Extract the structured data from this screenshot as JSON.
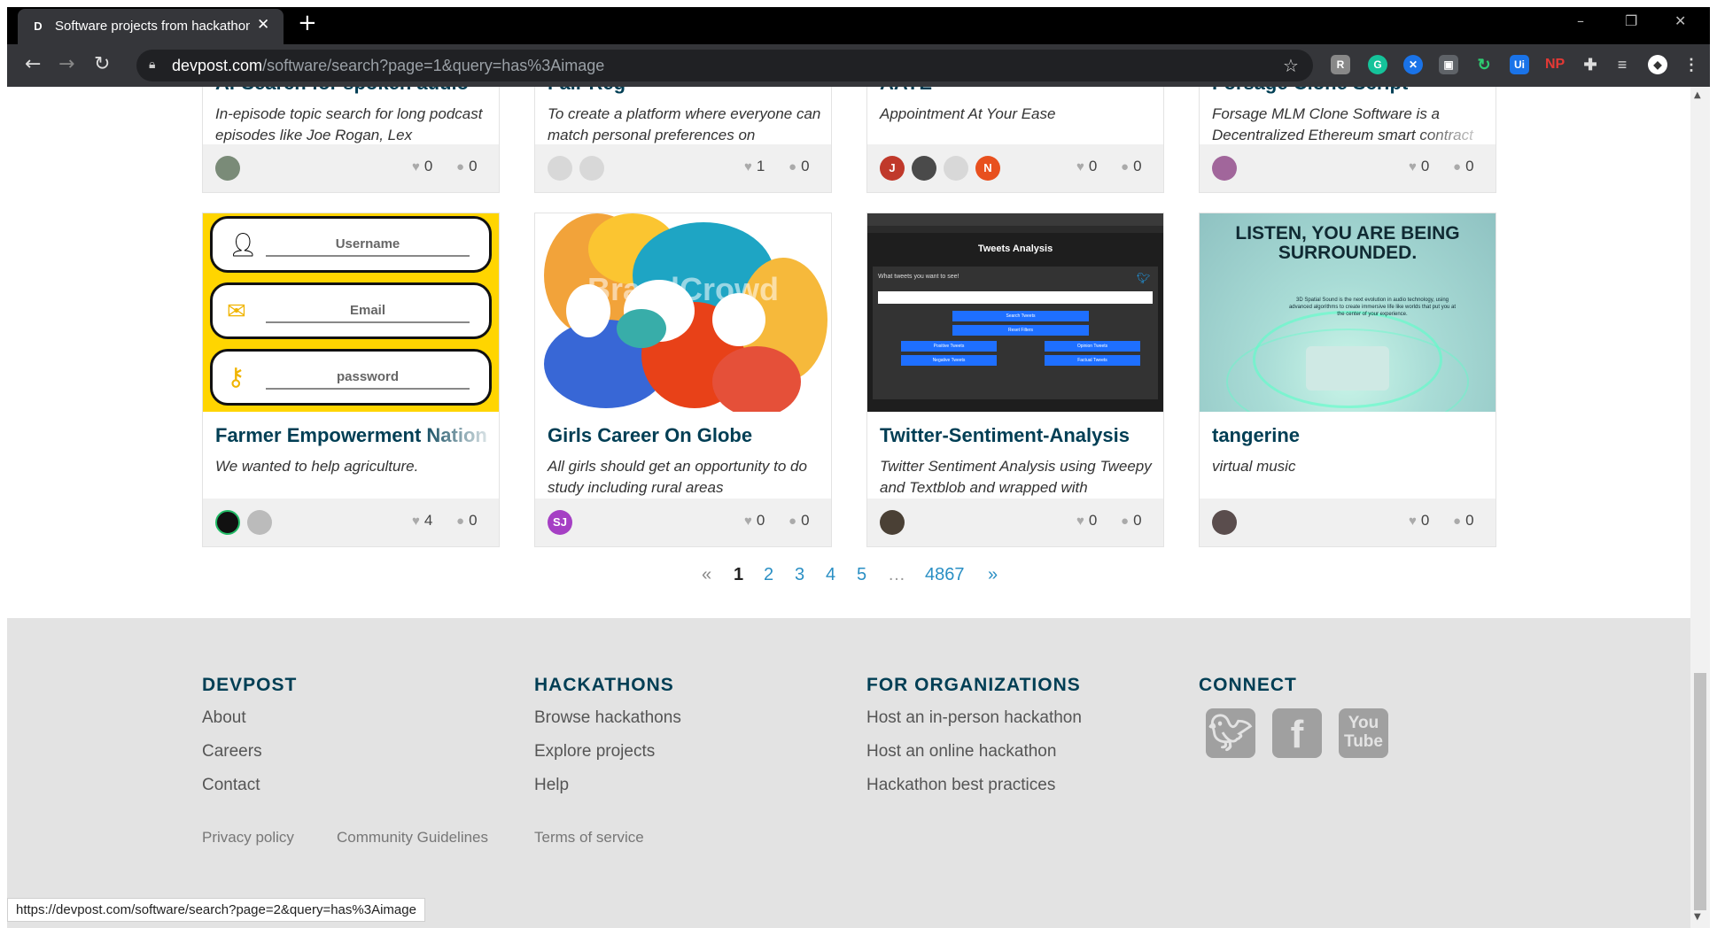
{
  "browser": {
    "tab_favicon": "D",
    "tab_title": "Software projects from hackathon",
    "url_domain": "devpost.com",
    "url_path": "/software/search?page=1&query=has%3Aimage",
    "status_url": "https://devpost.com/software/search?page=2&query=has%3Aimage",
    "ext": [
      "G",
      "Ui",
      "NP"
    ]
  },
  "top_cards": [
    {
      "title": "AI-Search for spoken audio",
      "tagline": "In-episode topic search for long podcast episodes like Joe Rogan, Lex",
      "likes": "0",
      "comments": "0"
    },
    {
      "title": "Fair Reg",
      "tagline": "To create a platform where everyone can match personal preferences on",
      "likes": "1",
      "comments": "0"
    },
    {
      "title": "AAYE",
      "tagline": "Appointment At Your Ease",
      "likes": "0",
      "comments": "0",
      "avatars": [
        "J",
        "N"
      ]
    },
    {
      "title": "Forsage Clone Script",
      "tagline": "Forsage MLM Clone Software is a Decentralized Ethereum smart contract",
      "likes": "0",
      "comments": "0"
    }
  ],
  "cards": [
    {
      "title": "Farmer Empowerment Nation",
      "tagline": "We wanted to help agriculture.",
      "likes": "4",
      "comments": "0",
      "image": {
        "fields": [
          "Username",
          "Email",
          "password"
        ]
      }
    },
    {
      "title": "Girls Career On Globe",
      "tagline": "All girls should get an opportunity to do study including rural areas",
      "likes": "0",
      "comments": "0",
      "avatar": "SJ",
      "image": {
        "watermark": "BrandCrowd"
      }
    },
    {
      "title": "Twitter-Sentiment-Analysis",
      "tagline": "Twitter Sentiment Analysis using Tweepy and Textblob and wrapped with",
      "likes": "0",
      "comments": "0",
      "image": {
        "heading": "Tweets Analysis",
        "prompt": "What tweets you want to see!",
        "buttons": [
          "Search Tweets",
          "Reset Filters",
          "Positive Tweets",
          "Opinion Tweets",
          "Negative Tweets",
          "Factual Tweets"
        ]
      }
    },
    {
      "title": "tangerine",
      "tagline": "virtual music",
      "likes": "0",
      "comments": "0",
      "image": {
        "headline": "LISTEN, YOU ARE BEING SURROUNDED.",
        "body": "3D Spatial Sound is the next evolution in audio technology, using advanced algorithms to create immersive life like worlds that put you at the center of your experience."
      }
    }
  ],
  "pagination": {
    "prev": "«",
    "pages": [
      "1",
      "2",
      "3",
      "4",
      "5"
    ],
    "ellipsis": "…",
    "last": "4867",
    "next": "»"
  },
  "footer": {
    "cols": [
      {
        "heading": "DEVPOST",
        "links": [
          "About",
          "Careers",
          "Contact"
        ]
      },
      {
        "heading": "HACKATHONS",
        "links": [
          "Browse hackathons",
          "Explore projects",
          "Help"
        ]
      },
      {
        "heading": "FOR ORGANIZATIONS",
        "links": [
          "Host an in-person hackathon",
          "Host an online hackathon",
          "Hackathon best practices"
        ]
      },
      {
        "heading": "CONNECT",
        "links": []
      }
    ],
    "small": [
      "Privacy policy",
      "Community Guidelines",
      "Terms of service"
    ],
    "social": [
      "twitter-icon",
      "facebook-icon",
      "youtube-icon"
    ],
    "youtube_label": "You Tube"
  },
  "colors": {
    "title": "#003e54",
    "link": "#2a8fc4",
    "footer_bg": "#e3e3e3"
  }
}
